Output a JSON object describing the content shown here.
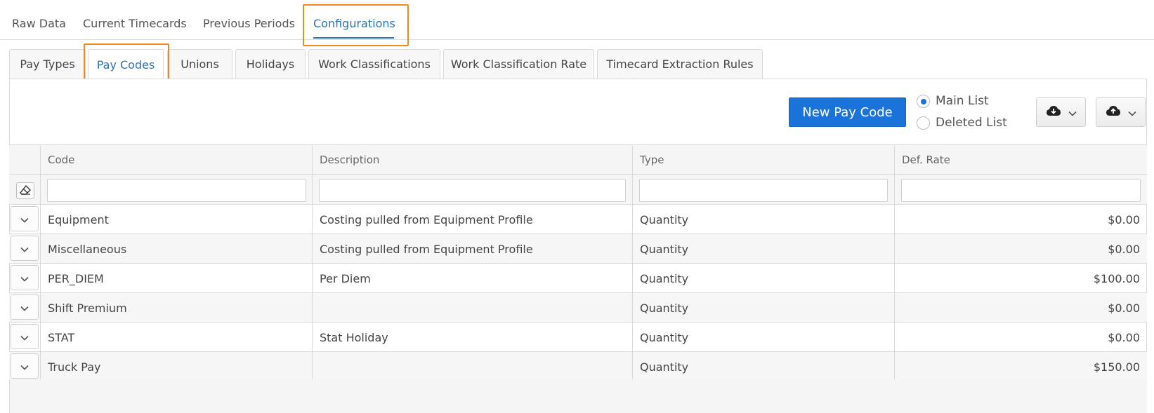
{
  "top_nav": {
    "tabs": [
      {
        "label": "Raw Data"
      },
      {
        "label": "Current Timecards"
      },
      {
        "label": "Previous Periods"
      },
      {
        "label": "Configurations"
      }
    ],
    "active_index": 3
  },
  "sub_tabs": {
    "tabs": [
      {
        "label": "Pay Types"
      },
      {
        "label": "Pay Codes"
      },
      {
        "label": "Unions"
      },
      {
        "label": "Holidays"
      },
      {
        "label": "Work Classifications"
      },
      {
        "label": "Work Classification Rate"
      },
      {
        "label": "Timecard Extraction Rules"
      }
    ],
    "active_index": 1
  },
  "toolbar": {
    "new_button_label": "New Pay Code",
    "list_options": [
      {
        "label": "Main List",
        "checked": true
      },
      {
        "label": "Deleted List",
        "checked": false
      }
    ],
    "icons": [
      "cloud-download-icon",
      "cloud-upload-icon"
    ]
  },
  "grid": {
    "columns": [
      "Code",
      "Description",
      "Type",
      "Def. Rate"
    ],
    "filters": [
      "",
      "",
      "",
      ""
    ],
    "rows": [
      {
        "code": "Equipment",
        "description": "Costing pulled from Equipment Profile",
        "type": "Quantity",
        "rate": "$0.00"
      },
      {
        "code": "Miscellaneous",
        "description": "Costing pulled from Equipment Profile",
        "type": "Quantity",
        "rate": "$0.00"
      },
      {
        "code": "PER_DIEM",
        "description": "Per Diem",
        "type": "Quantity",
        "rate": "$100.00"
      },
      {
        "code": "Shift Premium",
        "description": "",
        "type": "Quantity",
        "rate": "$0.00"
      },
      {
        "code": "STAT",
        "description": "Stat Holiday",
        "type": "Quantity",
        "rate": "$0.00"
      },
      {
        "code": "Truck Pay",
        "description": "",
        "type": "Quantity",
        "rate": "$150.00"
      }
    ]
  },
  "colors": {
    "accent": "#2a74b8",
    "primary_button": "#1a73d9",
    "highlight": "#f08a1c"
  }
}
